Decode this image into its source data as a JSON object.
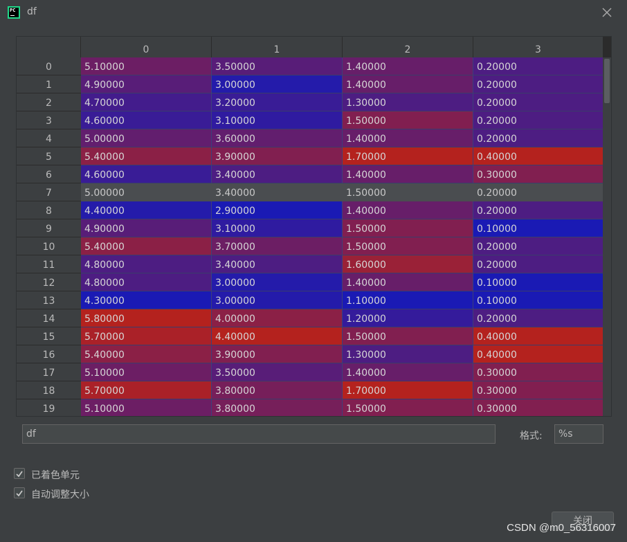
{
  "window": {
    "title": "df",
    "app_icon": "pycharm-icon",
    "close_icon": "close-icon"
  },
  "table": {
    "columns": [
      "0",
      "1",
      "2",
      "3"
    ],
    "selected_row": 7,
    "rows": [
      {
        "index": "0",
        "values": [
          "5.10000",
          "3.50000",
          "1.40000",
          "0.20000"
        ]
      },
      {
        "index": "1",
        "values": [
          "4.90000",
          "3.00000",
          "1.40000",
          "0.20000"
        ]
      },
      {
        "index": "2",
        "values": [
          "4.70000",
          "3.20000",
          "1.30000",
          "0.20000"
        ]
      },
      {
        "index": "3",
        "values": [
          "4.60000",
          "3.10000",
          "1.50000",
          "0.20000"
        ]
      },
      {
        "index": "4",
        "values": [
          "5.00000",
          "3.60000",
          "1.40000",
          "0.20000"
        ]
      },
      {
        "index": "5",
        "values": [
          "5.40000",
          "3.90000",
          "1.70000",
          "0.40000"
        ]
      },
      {
        "index": "6",
        "values": [
          "4.60000",
          "3.40000",
          "1.40000",
          "0.30000"
        ]
      },
      {
        "index": "7",
        "values": [
          "5.00000",
          "3.40000",
          "1.50000",
          "0.20000"
        ]
      },
      {
        "index": "8",
        "values": [
          "4.40000",
          "2.90000",
          "1.40000",
          "0.20000"
        ]
      },
      {
        "index": "9",
        "values": [
          "4.90000",
          "3.10000",
          "1.50000",
          "0.10000"
        ]
      },
      {
        "index": "10",
        "values": [
          "5.40000",
          "3.70000",
          "1.50000",
          "0.20000"
        ]
      },
      {
        "index": "11",
        "values": [
          "4.80000",
          "3.40000",
          "1.60000",
          "0.20000"
        ]
      },
      {
        "index": "12",
        "values": [
          "4.80000",
          "3.00000",
          "1.40000",
          "0.10000"
        ]
      },
      {
        "index": "13",
        "values": [
          "4.30000",
          "3.00000",
          "1.10000",
          "0.10000"
        ]
      },
      {
        "index": "14",
        "values": [
          "5.80000",
          "4.00000",
          "1.20000",
          "0.20000"
        ]
      },
      {
        "index": "15",
        "values": [
          "5.70000",
          "4.40000",
          "1.50000",
          "0.40000"
        ]
      },
      {
        "index": "16",
        "values": [
          "5.40000",
          "3.90000",
          "1.30000",
          "0.40000"
        ]
      },
      {
        "index": "17",
        "values": [
          "5.10000",
          "3.50000",
          "1.40000",
          "0.30000"
        ]
      },
      {
        "index": "18",
        "values": [
          "5.70000",
          "3.80000",
          "1.70000",
          "0.30000"
        ]
      },
      {
        "index": "19",
        "values": [
          "5.10000",
          "3.80000",
          "1.50000",
          "0.30000"
        ]
      }
    ]
  },
  "colors": {
    "low": "#1a1ab4",
    "high": "#b4221e",
    "background": "#3c3f41"
  },
  "name_field": {
    "value": "df"
  },
  "format": {
    "label": "格式:",
    "value": "%s"
  },
  "options": {
    "colored_cells": {
      "label": "已着色单元",
      "checked": true
    },
    "auto_resize": {
      "label": "自动调整大小",
      "checked": true
    }
  },
  "buttons": {
    "close_label": "关闭"
  },
  "watermark": "CSDN @m0_56316007"
}
